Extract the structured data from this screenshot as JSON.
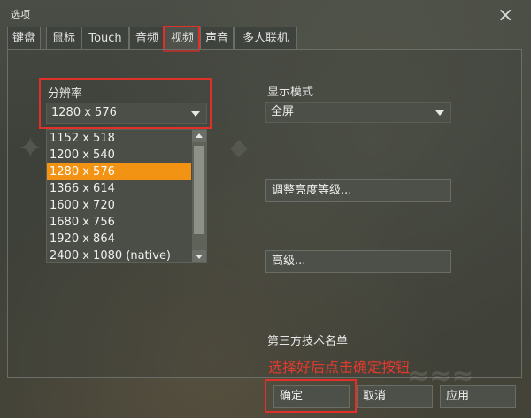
{
  "window": {
    "title": "选项",
    "close_glyph": "×"
  },
  "tabs": [
    {
      "label": "键盘"
    },
    {
      "label": "鼠标"
    },
    {
      "label": "Touch"
    },
    {
      "label": "音频"
    },
    {
      "label": "视频",
      "active": true
    },
    {
      "label": "声音"
    },
    {
      "label": "多人联机"
    }
  ],
  "resolution": {
    "label": "分辨率",
    "selected": "1280 x 576",
    "options": [
      "1152 x 518",
      "1200 x 540",
      "1280 x 576",
      "1366 x 614",
      "1600 x 720",
      "1680 x 756",
      "1920 x 864",
      "2400 x 1080 (native)"
    ],
    "selected_index": 2
  },
  "display_mode": {
    "label": "显示模式",
    "selected": "全屏"
  },
  "buttons": {
    "brightness": "调整亮度等级...",
    "advanced": "高级...",
    "ok": "确定",
    "cancel": "取消",
    "apply": "应用"
  },
  "third_party_label": "第三方技术名单",
  "annotation_text": "选择好后点击确定按钮",
  "highlight_color": "#e0302a",
  "selection_color": "#f39313"
}
